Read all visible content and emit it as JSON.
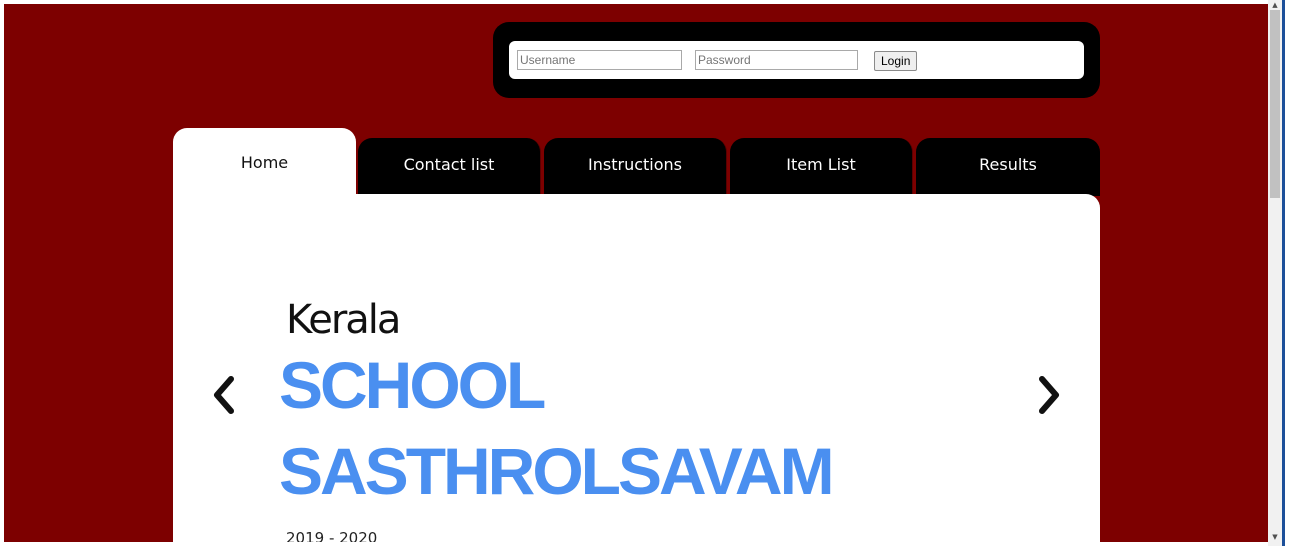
{
  "login": {
    "username_placeholder": "Username",
    "password_placeholder": "Password",
    "login_label": "Login"
  },
  "nav": {
    "tabs": [
      {
        "label": "Home",
        "active": true
      },
      {
        "label": "Contact list",
        "active": false
      },
      {
        "label": "Instructions",
        "active": false
      },
      {
        "label": "Item List",
        "active": false
      },
      {
        "label": "Results",
        "active": false
      }
    ]
  },
  "slide": {
    "pretitle": "Kerala",
    "title_line1": "SCHOOL",
    "title_line2": "SASTHROLSAVAM",
    "date": "2019 - 2020",
    "prev_icon": "chevron-left-icon",
    "next_icon": "chevron-right-icon"
  },
  "colors": {
    "background": "#7d0000",
    "title_blue": "#4a8ff0",
    "tab_black": "#000000"
  }
}
